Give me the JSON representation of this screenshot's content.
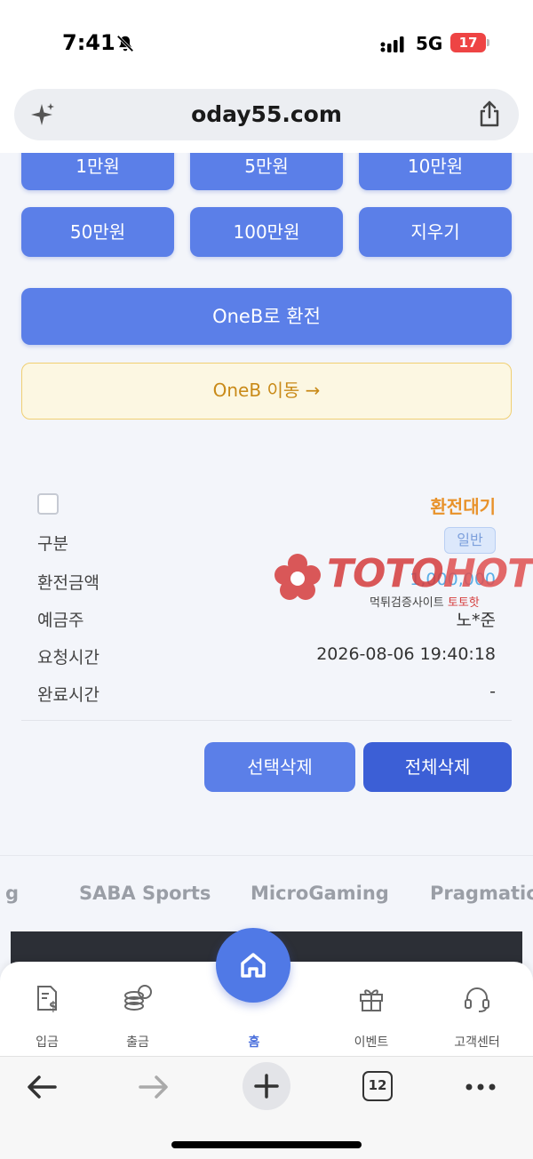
{
  "status_bar": {
    "time": "7:41",
    "network": "5G",
    "battery": "17"
  },
  "browser": {
    "url": "oday55.com"
  },
  "amount_buttons": [
    {
      "label": "1만원"
    },
    {
      "label": "5만원"
    },
    {
      "label": "10만원"
    },
    {
      "label": "50만원"
    },
    {
      "label": "100만원"
    },
    {
      "label": "지우기"
    }
  ],
  "actions": {
    "exchange": "OneB로 환전",
    "move": "OneB 이동 →"
  },
  "record": {
    "status": "환전대기",
    "rows": {
      "type": {
        "label": "구분",
        "value": "일반"
      },
      "amount": {
        "label": "환전금액",
        "value": "1,000,000"
      },
      "holder": {
        "label": "예금주",
        "value": "노*준"
      },
      "requested": {
        "label": "요청시간",
        "value": "2026-08-06 19:40:18"
      },
      "completed": {
        "label": "완료시간",
        "value": "-"
      }
    }
  },
  "delete_buttons": {
    "selected": "선택삭제",
    "all": "전체삭제"
  },
  "watermark": {
    "brand_a": "TOTO",
    "brand_b": "HOT",
    "subtitle": "먹튀검증사이트",
    "subtitle_accent": "토토핫"
  },
  "providers": [
    "g",
    "SABA Sports",
    "MicroGaming",
    "Pragmatic"
  ],
  "bottom_nav": {
    "deposit": "입금",
    "withdraw": "출금",
    "home": "홈",
    "event": "이벤트",
    "support": "고객센터"
  },
  "toolbar": {
    "tab_count": "12"
  },
  "colors": {
    "primary": "#5b7fe8",
    "primary_dark": "#3c5fd6",
    "warning": "#e8922a",
    "watermark": "#d53c3c"
  }
}
